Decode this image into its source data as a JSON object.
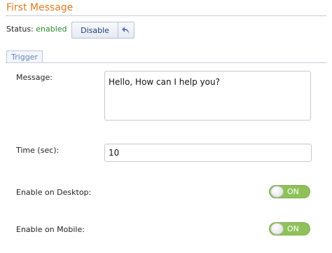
{
  "header": {
    "title": "First Message"
  },
  "status": {
    "label": "Status:",
    "value": "enabled"
  },
  "actions": {
    "disable_label": "Disable",
    "undo_icon": "undo-arrow"
  },
  "section": {
    "tab_label": "Trigger"
  },
  "form": {
    "message_label": "Message:",
    "message_value": "Hello, How can I help you?",
    "time_label": "Time (sec):",
    "time_value": "10",
    "desktop_label": "Enable on Desktop:",
    "desktop_toggle": "ON",
    "mobile_label": "Enable on Mobile:",
    "mobile_toggle": "ON"
  },
  "colors": {
    "accent": "#e07b22",
    "status_ok": "#2a8a2a",
    "toggle_on": "#8fc15a"
  }
}
